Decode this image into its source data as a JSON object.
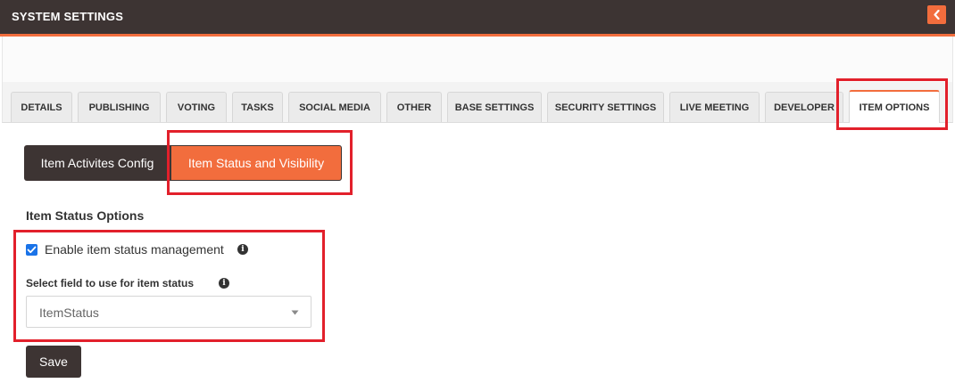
{
  "header": {
    "title": "SYSTEM SETTINGS",
    "collapse_icon": "chevron-left-icon",
    "accent_color": "#f26d3d",
    "bar_color": "#3d3433"
  },
  "tabs": [
    {
      "label": "DETAILS",
      "active": false
    },
    {
      "label": "PUBLISHING",
      "active": false
    },
    {
      "label": "VOTING",
      "active": false
    },
    {
      "label": "TASKS",
      "active": false
    },
    {
      "label": "SOCIAL MEDIA",
      "active": false
    },
    {
      "label": "OTHER",
      "active": false
    },
    {
      "label": "BASE SETTINGS",
      "active": false
    },
    {
      "label": "SECURITY SETTINGS",
      "active": false
    },
    {
      "label": "LIVE MEETING",
      "active": false
    },
    {
      "label": "DEVELOPER",
      "active": false
    },
    {
      "label": "ITEM OPTIONS",
      "active": true
    }
  ],
  "subtabs": {
    "items": [
      {
        "label": "Item Activites Config",
        "active": false
      },
      {
        "label": "Item Status and Visibility",
        "active": true
      }
    ]
  },
  "section": {
    "title": "Item Status Options",
    "enable_checkbox": {
      "label": "Enable item status management",
      "checked": true
    },
    "status_field": {
      "label": "Select field to use for item status",
      "value": "ItemStatus"
    }
  },
  "actions": {
    "save_label": "Save"
  },
  "highlight_color": "#e2202b"
}
